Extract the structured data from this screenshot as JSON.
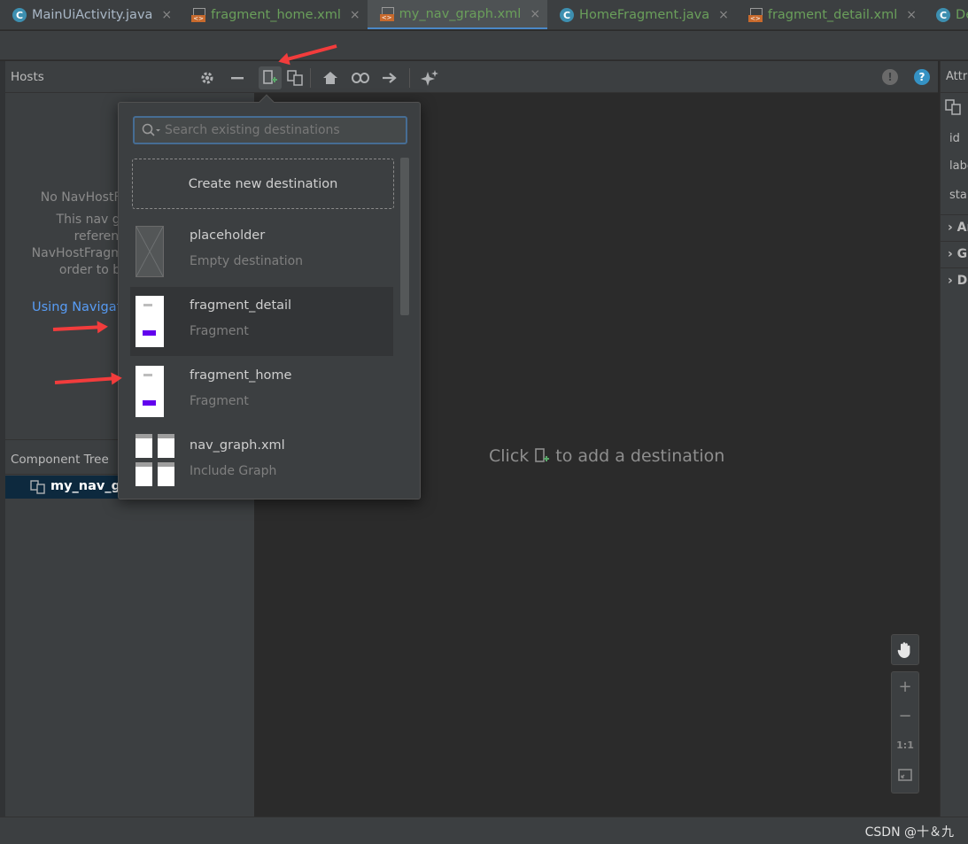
{
  "tabs": [
    {
      "label": "MainUiActivity.java",
      "icon": "java-class-icon",
      "active": false,
      "color": "#a9b7c6"
    },
    {
      "label": "fragment_home.xml",
      "icon": "xml-file-icon",
      "active": false,
      "color": "#6a9f5b"
    },
    {
      "label": "my_nav_graph.xml",
      "icon": "xml-file-icon",
      "active": true,
      "color": "#6a9f5b"
    },
    {
      "label": "HomeFragment.java",
      "icon": "java-class-icon",
      "active": false,
      "color": "#6a9f5b"
    },
    {
      "label": "fragment_detail.xml",
      "icon": "xml-file-icon",
      "active": false,
      "color": "#6a9f5b"
    },
    {
      "label": "DetailFragment.java",
      "icon": "java-class-icon",
      "active": false,
      "color": "#6a9f5b"
    }
  ],
  "hosts": {
    "title": "Hosts",
    "message_lines": [
      "No NavHostFragments found",
      "This nav graph must be",
      "referenced from a",
      "NavHostFragment in a layout in",
      "order to be accessible."
    ],
    "link": "Using Navigation Editor"
  },
  "component_tree": {
    "title": "Component Tree",
    "root": "my_nav_graph"
  },
  "popup": {
    "search_placeholder": "Search existing destinations",
    "create_label": "Create new destination",
    "destinations": [
      {
        "name": "placeholder",
        "type": "Empty destination",
        "thumb": "placeholder"
      },
      {
        "name": "fragment_detail",
        "type": "Fragment",
        "thumb": "fragment"
      },
      {
        "name": "fragment_home",
        "type": "Fragment",
        "thumb": "fragment"
      },
      {
        "name": "nav_graph.xml",
        "type": "Include Graph",
        "thumb": "graph"
      }
    ]
  },
  "canvas": {
    "empty_prefix": "Click",
    "empty_suffix": "to add a destination"
  },
  "zoom": {
    "one_to_one": "1:1"
  },
  "attributes": {
    "title": "Attributes",
    "fields": [
      "id",
      "label",
      "startDestination"
    ],
    "sections": [
      "Argument Default Values",
      "Global Actions",
      "Deep Links"
    ]
  },
  "watermark": "CSDN @十＆九",
  "colors": {
    "accent": "#4a88c7",
    "add_green": "#59a869",
    "help_blue": "#3592c4",
    "arrow_red": "#f23c3c"
  }
}
